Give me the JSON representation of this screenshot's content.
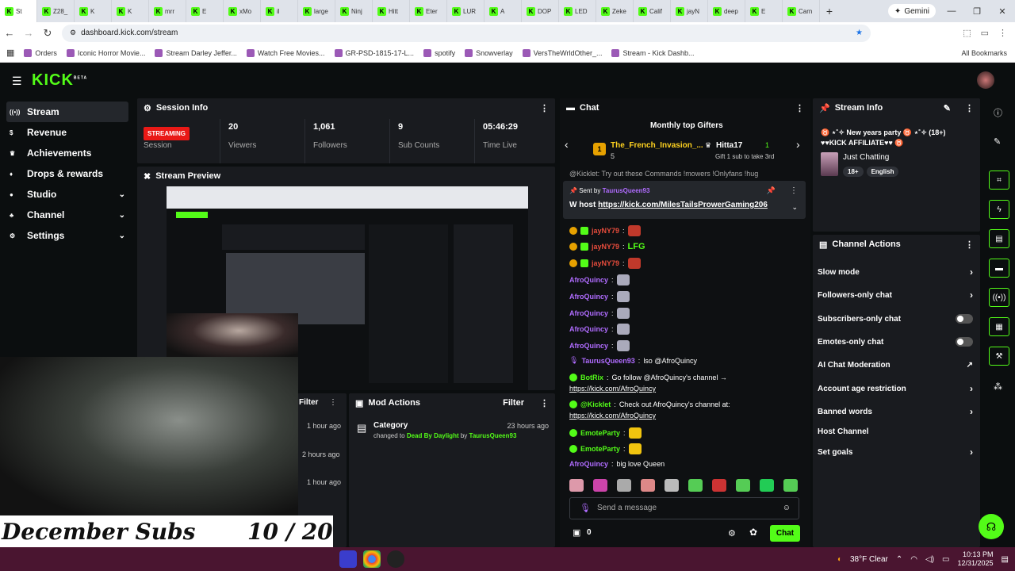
{
  "browser": {
    "tabs": [
      "St",
      "Z28_",
      "K",
      "K",
      "mrr",
      "E",
      "xMo",
      "il",
      "large",
      "Ninj",
      "Hitt",
      "Eter",
      "LUR",
      "A",
      "DOP",
      "LED",
      "Zeke",
      "Calif",
      "jayN",
      "deep",
      "E",
      "Carn"
    ],
    "new_tab": "+",
    "gemini_label": "Gemini",
    "url": "dashboard.kick.com/stream",
    "bookmarks": [
      "Orders",
      "Iconic Horror Movie...",
      "Stream Darley Jeffer...",
      "Watch Free Movies...",
      "GR-PSD-1815-17-L...",
      "spotify",
      "Snowverlay",
      "VersTheWrldOther_...",
      "Stream - Kick Dashb..."
    ],
    "all_bookmarks": "All Bookmarks",
    "colors": {
      "tabbar": "#dfe3ea",
      "accent": "#53fc18"
    }
  },
  "app": {
    "logo": "KICK",
    "logo_beta": "BETA"
  },
  "sidebar": {
    "items": [
      {
        "label": "Stream",
        "icon": "broadcast-icon",
        "active": true
      },
      {
        "label": "Revenue",
        "icon": "money-icon"
      },
      {
        "label": "Achievements",
        "icon": "trophy-icon"
      },
      {
        "label": "Drops & rewards",
        "icon": "gift-icon"
      },
      {
        "label": "Studio",
        "icon": "studio-icon",
        "expand": true
      },
      {
        "label": "Channel",
        "icon": "channel-icon",
        "expand": true
      },
      {
        "label": "Settings",
        "icon": "gear-icon",
        "expand": true
      }
    ]
  },
  "session": {
    "title": "Session Info",
    "status": "STREAMING",
    "status_label": "Session",
    "viewers": "20",
    "viewers_label": "Viewers",
    "followers": "1,061",
    "followers_label": "Followers",
    "subs": "9",
    "subs_label": "Sub Counts",
    "time": "05:46:29",
    "time_label": "Time Live"
  },
  "preview": {
    "title": "Stream Preview"
  },
  "overlay": {
    "title": "December Subs",
    "progress": "10 / 20",
    "progress_fraction": 0.5
  },
  "left_lower": {
    "filter": "Filter",
    "times": [
      "1 hour ago",
      "2 hours ago",
      "1 hour ago"
    ]
  },
  "mod_actions": {
    "title": "Mod Actions",
    "filter": "Filter",
    "entry_title": "Category",
    "entry_time": "23 hours ago",
    "entry_prefix": "changed to",
    "entry_game": "Dead By Daylight",
    "entry_by": "by",
    "entry_user": "TaurusQueen93"
  },
  "chat": {
    "title": "Chat",
    "gifters_title": "Monthly top Gifters",
    "gifter1": "The_French_Invasion_...",
    "gifter1_count": "5",
    "gifter1_rank": "1",
    "gifter2": "Hitta17",
    "gifter2_count": "1",
    "gifter2_note": "Gift 1 sub to take 3rd",
    "cut_line": "@Kicklet: Try out these Commands !mowers !Onlyfans !hug",
    "pinned_sent_by": "Sent by",
    "pinned_user": "TaurusQueen93",
    "pinned_text": "W host",
    "pinned_link": "https://kick.com/MilesTailsProwerGaming206",
    "messages": [
      {
        "user": "jayNY79",
        "text": "",
        "color": "#e74c3c"
      },
      {
        "user": "jayNY79",
        "text": "LFG",
        "color": "#e74c3c"
      },
      {
        "user": "jayNY79",
        "text": "",
        "color": "#e74c3c"
      },
      {
        "user": "AfroQuincy",
        "text": "",
        "color": "#b06cff"
      },
      {
        "user": "AfroQuincy",
        "text": "",
        "color": "#b06cff"
      },
      {
        "user": "AfroQuincy",
        "text": "",
        "color": "#b06cff"
      },
      {
        "user": "AfroQuincy",
        "text": "",
        "color": "#b06cff"
      },
      {
        "user": "AfroQuincy",
        "text": "",
        "color": "#b06cff"
      },
      {
        "user": "TaurusQueen93",
        "text": "lso @AfroQuincy",
        "color": "#b06cff"
      },
      {
        "user": "BotRix",
        "text": "Go follow @AfroQuincy's channel →",
        "link": "https://kick.com/AfroQuincy",
        "color": "#53fc18"
      },
      {
        "user": "@Kicklet",
        "text": "Check out AfroQuincy's channel at:",
        "link": "https://kick.com/AfroQuincy",
        "color": "#53fc18"
      },
      {
        "user": "EmoteParty",
        "text": "",
        "color": "#53fc18"
      },
      {
        "user": "EmoteParty",
        "text": "",
        "color": "#53fc18"
      },
      {
        "user": "AfroQuincy",
        "text": "big love Queen",
        "color": "#b06cff"
      }
    ],
    "input_placeholder": "Send a message",
    "points": "0",
    "send_label": "Chat"
  },
  "stream_info": {
    "title": "Stream Info",
    "stream_title": "♉ ⋆˚✧ New years party ♉ ⋆˚✧ (18+) ♥♥KICK AFFILIATE♥♥ ♉",
    "category": "Just Chatting",
    "tags": [
      "18+",
      "English"
    ]
  },
  "channel_actions": {
    "title": "Channel Actions",
    "rows": [
      {
        "label": "Slow mode",
        "kind": "chevron"
      },
      {
        "label": "Followers-only chat",
        "kind": "chevron"
      },
      {
        "label": "Subscribers-only chat",
        "kind": "toggle"
      },
      {
        "label": "Emotes-only chat",
        "kind": "toggle"
      },
      {
        "label": "AI Chat Moderation",
        "kind": "external"
      },
      {
        "label": "Account age restriction",
        "kind": "chevron"
      },
      {
        "label": "Banned words",
        "kind": "chevron"
      },
      {
        "label": "Host Channel",
        "kind": "none"
      },
      {
        "label": "Set goals",
        "kind": "chevron"
      }
    ]
  },
  "taskbar": {
    "weather": "38°F Clear",
    "time": "10:13 PM",
    "date": "12/31/2025"
  }
}
